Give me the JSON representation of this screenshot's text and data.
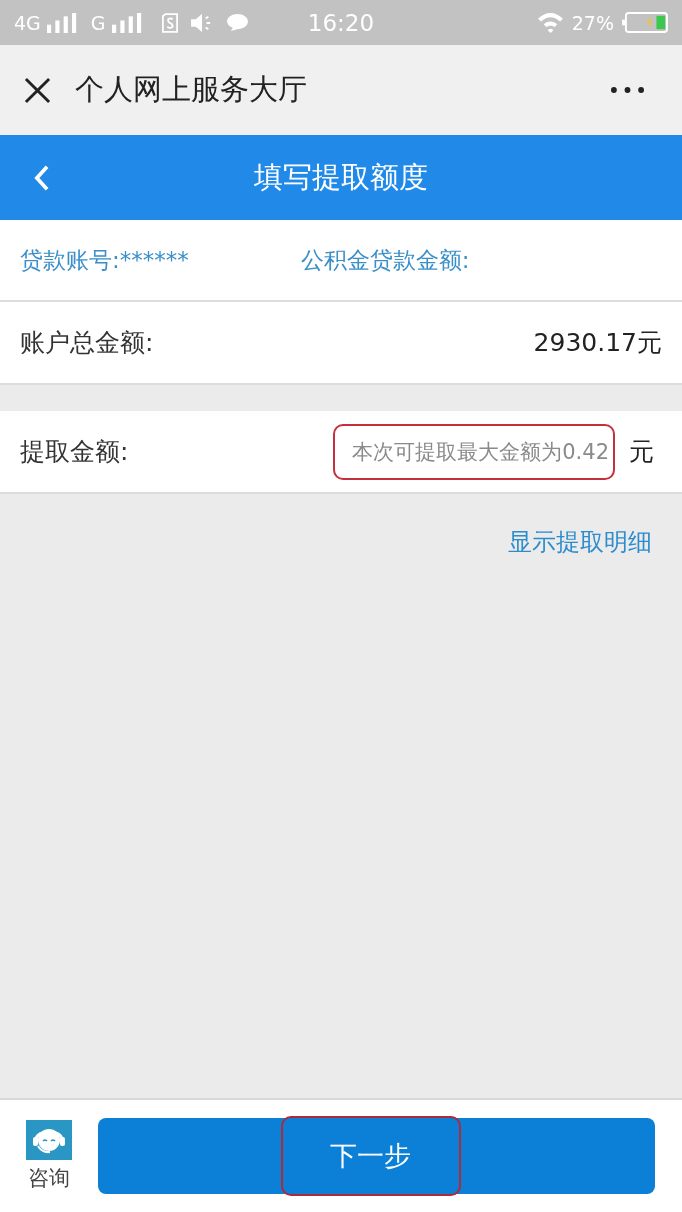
{
  "status_bar": {
    "network_1": "4G",
    "network_2": "G",
    "time": "16:20",
    "battery": "27%"
  },
  "header": {
    "title": "个人网上服务大厅"
  },
  "nav_bar": {
    "title": "填写提取额度"
  },
  "loan_info": {
    "account_label": "贷款账号:******",
    "amount_label": "公积金贷款金额:"
  },
  "total": {
    "label": "账户总金额:",
    "value": "2930.17元"
  },
  "withdraw": {
    "label": "提取金额:",
    "placeholder": "本次可提取最大金额为0.42",
    "unit": "元",
    "highlighted": true
  },
  "detail_link": "显示提取明细",
  "footer": {
    "consult_label": "咨询",
    "next_button": {
      "label": "下一步",
      "highlighted": true
    }
  }
}
